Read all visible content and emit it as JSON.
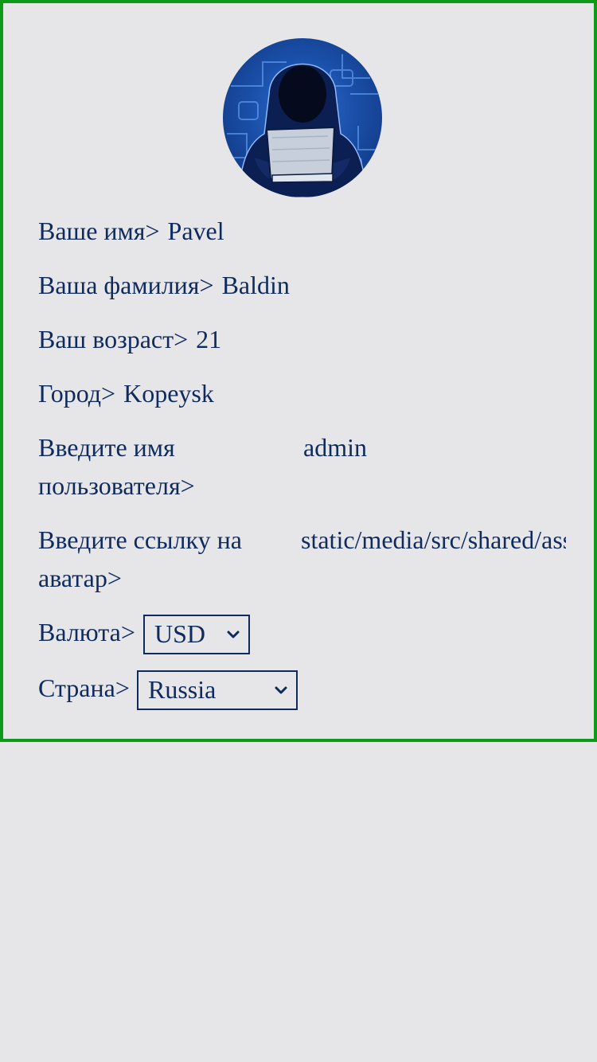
{
  "profile": {
    "avatar_icon": "hacker-avatar-icon",
    "fields": {
      "first_name": {
        "label": "Ваше имя>",
        "value": "Pavel"
      },
      "last_name": {
        "label": "Ваша фамилия>",
        "value": "Baldin"
      },
      "age": {
        "label": "Ваш возраст>",
        "value": "21"
      },
      "city": {
        "label": "Город>",
        "value": "Kopeysk"
      },
      "username": {
        "label": "Введите имя пользователя>",
        "value": "admin"
      },
      "avatar_link": {
        "label": "Введите ссылку на аватар>",
        "value": "static/media/src/shared/ass"
      }
    },
    "currency": {
      "label": "Валюта>",
      "selected": "USD"
    },
    "country": {
      "label": "Страна>",
      "selected": "Russia"
    }
  },
  "colors": {
    "text": "#0f2a5c",
    "border_green": "#0c9a17",
    "background": "#e6e6e8"
  }
}
